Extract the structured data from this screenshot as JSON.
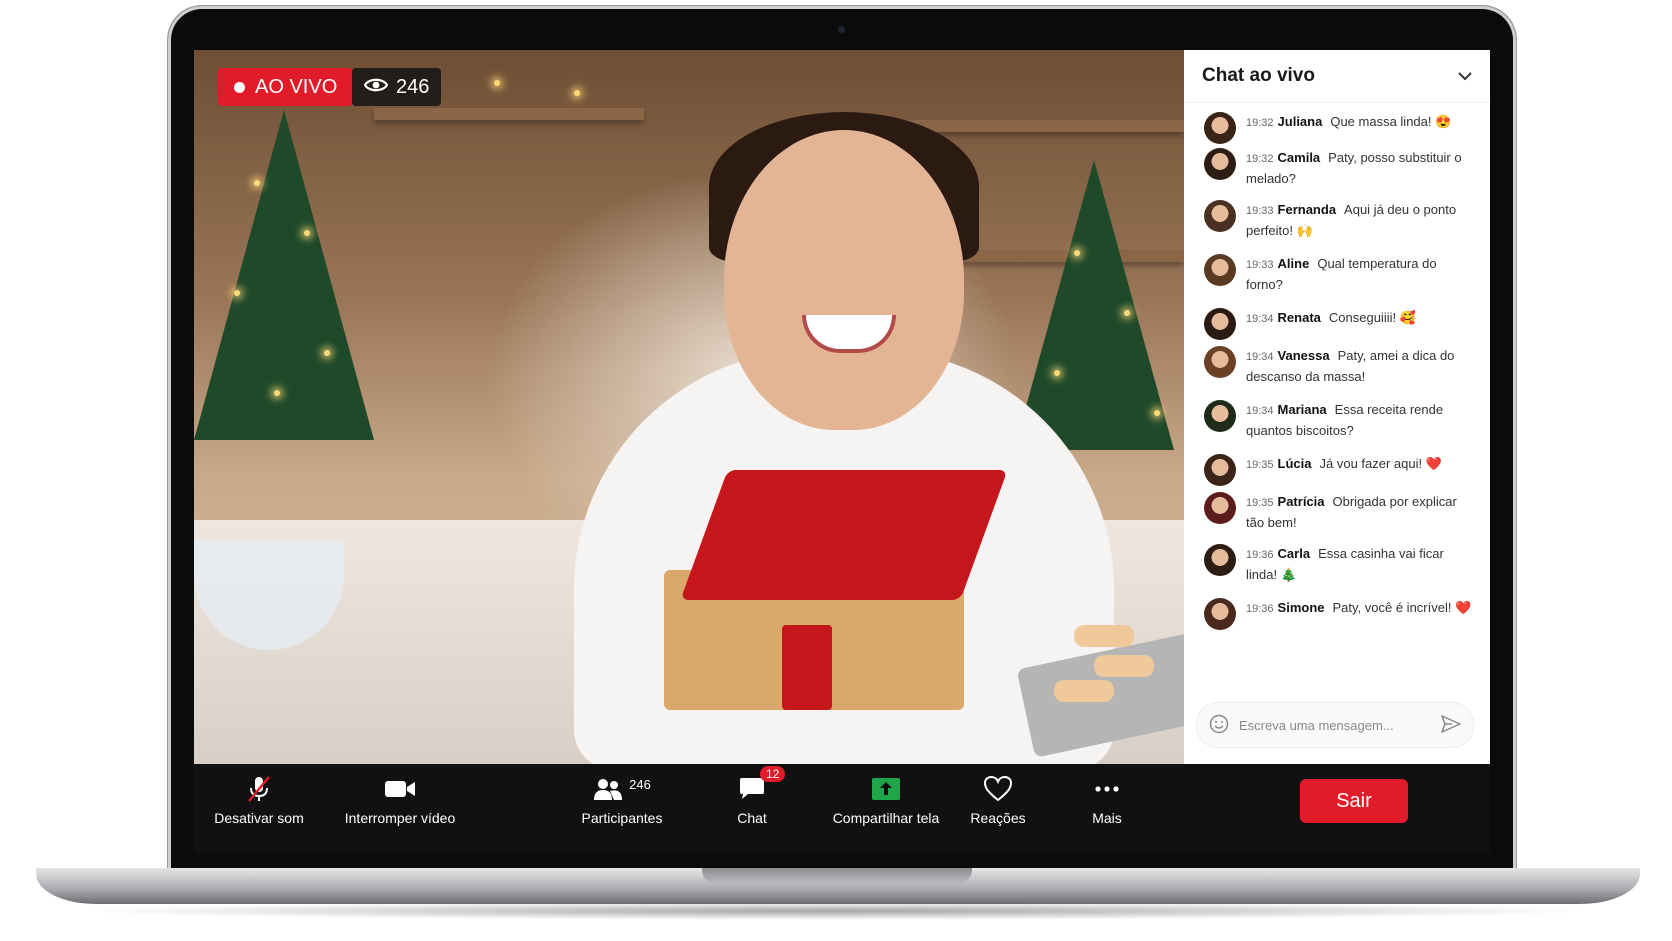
{
  "stream": {
    "live_label": "AO VIVO",
    "viewer_count": "246"
  },
  "chat": {
    "title": "Chat ao vivo",
    "input_placeholder": "Escreva uma mensagem...",
    "messages": [
      {
        "time": "19:32",
        "name": "Juliana",
        "text": "Que massa linda! 😍"
      },
      {
        "time": "19:32",
        "name": "Camila",
        "text": "Paty, posso substituir o melado?"
      },
      {
        "time": "19:33",
        "name": "Fernanda",
        "text": "Aqui já deu o ponto perfeito! 🙌"
      },
      {
        "time": "19:33",
        "name": "Aline",
        "text": "Qual temperatura do forno?"
      },
      {
        "time": "19:34",
        "name": "Renata",
        "text": "Conseguiiii! 🥰"
      },
      {
        "time": "19:34",
        "name": "Vanessa",
        "text": "Paty, amei a dica do descanso da massa!"
      },
      {
        "time": "19:34",
        "name": "Mariana",
        "text": "Essa receita rende quantos biscoitos?"
      },
      {
        "time": "19:35",
        "name": "Lúcia",
        "text": "Já vou fazer aqui! ❤️"
      },
      {
        "time": "19:35",
        "name": "Patrícia",
        "text": "Obrigada por explicar tão bem!"
      },
      {
        "time": "19:36",
        "name": "Carla",
        "text": "Essa casinha vai ficar linda! 🎄"
      },
      {
        "time": "19:36",
        "name": "Simone",
        "text": "Paty, você é incrível! ❤️"
      }
    ]
  },
  "toolbar": {
    "mute_label": "Desativar som",
    "video_label": "Interromper vídeo",
    "participants_label": "Participantes",
    "participants_count": "246",
    "chat_label": "Chat",
    "chat_badge": "12",
    "share_label": "Compartilhar tela",
    "reactions_label": "Reações",
    "more_label": "Mais",
    "exit_label": "Sair"
  },
  "icons": {
    "mic": "mic-off-icon",
    "video": "video-camera-icon",
    "participants": "people-icon",
    "chat": "chat-bubble-icon",
    "share": "share-screen-icon",
    "reactions": "heart-icon",
    "more": "more-dots-icon",
    "emoji": "emoji-icon",
    "send": "send-icon",
    "eye": "eye-icon",
    "chevron": "chevron-down-icon"
  },
  "colors": {
    "accent": "#e21b2a",
    "share_green": "#1fa64a",
    "toolbar_bg": "#111111"
  }
}
